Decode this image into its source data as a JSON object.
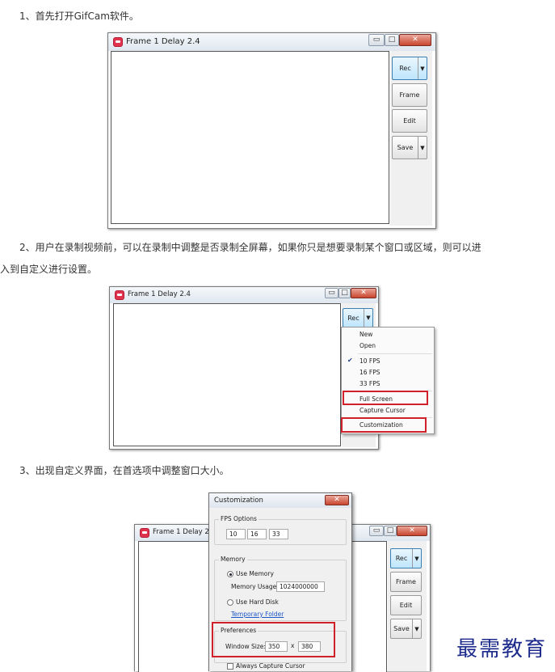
{
  "steps": {
    "s1": "1、首先打开GifCam软件。",
    "s2_line1": "2、用户在录制视频前，可以在录制中调整是否录制全屏幕，如果你只是想要录制某个窗口或区域，则可以进",
    "s2_line2": "入到自定义进行设置。",
    "s3": "3、出现自定义界面，在首选项中调整窗口大小。"
  },
  "app": {
    "title": "Frame 1 Delay 2.4",
    "title_partial": "Frame 1 Delay 2.4",
    "buttons": {
      "rec": "Rec",
      "frame": "Frame",
      "edit": "Edit",
      "save": "Save"
    },
    "win_controls": {
      "minimize": "▭",
      "maximize": "□",
      "close": "✕"
    }
  },
  "rec_menu": {
    "items": [
      "New",
      "Open",
      "10 FPS",
      "16 FPS",
      "33 FPS",
      "Full Screen",
      "Capture Cursor",
      "Customization"
    ],
    "checked": "10 FPS",
    "highlighted": [
      "Full Screen",
      "Customization"
    ]
  },
  "customization": {
    "title": "Customization",
    "fps_group": "FPS Options",
    "fps_values": [
      "10",
      "16",
      "33"
    ],
    "memory_group": "Memory",
    "use_memory": "Use Memory",
    "memory_usage_label": "Memory Usage:",
    "memory_usage_value": "1024000000",
    "use_hard_disk": "Use Hard Disk",
    "temp_folder_link": "Temporary Folder",
    "preferences_group": "Preferences",
    "window_size_label": "Window Size:",
    "window_width": "350",
    "window_sep": "x",
    "window_height": "380",
    "always_capture_cursor": "Always Capture Cursor"
  },
  "watermark": "最需教育",
  "colors": {
    "highlight_red": "#d0202a",
    "link_blue": "#1a56c8",
    "close_red": "#c9462f"
  }
}
